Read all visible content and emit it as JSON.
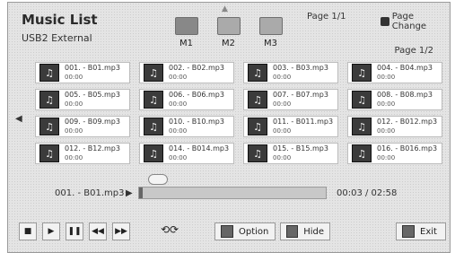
{
  "header": {
    "title": "Music List",
    "subtitle": "USB2 External",
    "tabs": [
      {
        "label": "M1"
      },
      {
        "label": "M2"
      },
      {
        "label": "M3"
      }
    ],
    "page_top": "Page 1/1",
    "page_change": "Page Change",
    "page_right": "Page 1/2"
  },
  "tracks": [
    {
      "name": "001. - B01.mp3",
      "dur": "00:00"
    },
    {
      "name": "002. - B02.mp3",
      "dur": "00:00"
    },
    {
      "name": "003. - B03.mp3",
      "dur": "00:00"
    },
    {
      "name": "004. - B04.mp3",
      "dur": "00:00"
    },
    {
      "name": "005. - B05.mp3",
      "dur": "00:00"
    },
    {
      "name": "006. - B06.mp3",
      "dur": "00:00"
    },
    {
      "name": "007. - B07.mp3",
      "dur": "00:00"
    },
    {
      "name": "008. - B08.mp3",
      "dur": "00:00"
    },
    {
      "name": "009. - B09.mp3",
      "dur": "00:00"
    },
    {
      "name": "010. - B10.mp3",
      "dur": "00:00"
    },
    {
      "name": "011. - B011.mp3",
      "dur": "00:00"
    },
    {
      "name": "012. - B012.mp3",
      "dur": "00:00"
    },
    {
      "name": "012. - B12.mp3",
      "dur": "00:00"
    },
    {
      "name": "014. - B014.mp3",
      "dur": "00:00"
    },
    {
      "name": "015. - B15.mp3",
      "dur": "00:00"
    },
    {
      "name": "016. - B016.mp3",
      "dur": "00:00"
    }
  ],
  "player": {
    "now_playing": "001. - B01.mp3",
    "time": "00:03 / 02:58",
    "progress_fraction": 0.02
  },
  "bottom": {
    "option_label": "Option",
    "hide_label": "Hide",
    "exit_label": "Exit",
    "loop_icon": "loop-icon"
  },
  "icons": {
    "stop": "stop-icon",
    "play": "play-icon",
    "pause": "pause-icon",
    "rewind": "rewind-icon",
    "forward": "forward-icon",
    "arrow_left": "arrow-left-icon",
    "arrow_right": "arrow-right-icon",
    "music": "music-note-icon"
  }
}
